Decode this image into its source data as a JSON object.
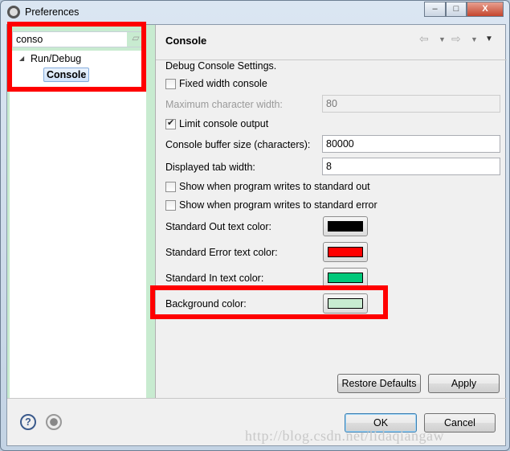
{
  "window": {
    "title": "Preferences",
    "icon": "gear-icon",
    "minimize": "–",
    "maximize": "□",
    "close": "X"
  },
  "filter": {
    "value": "conso",
    "clear_icon": "eraser-icon"
  },
  "tree": [
    {
      "label": "Run/Debug",
      "expanded": true
    },
    {
      "label": "Console",
      "selected": true
    }
  ],
  "page": {
    "title": "Console",
    "description": "Debug Console Settings.",
    "fixed_width": {
      "label": "Fixed width console",
      "checked": false
    },
    "max_width": {
      "label": "Maximum character width:",
      "value": "80",
      "enabled": false
    },
    "limit_output": {
      "label": "Limit console output",
      "checked": true
    },
    "buffer_size": {
      "label": "Console buffer size (characters):",
      "value": "80000"
    },
    "tab_width": {
      "label": "Displayed tab width:",
      "value": "8"
    },
    "show_out": {
      "label": "Show when program writes to standard out",
      "checked": false
    },
    "show_err": {
      "label": "Show when program writes to standard error",
      "checked": false
    },
    "colors": [
      {
        "label": "Standard Out text color:",
        "color": "#000000"
      },
      {
        "label": "Standard Error text color:",
        "color": "#ff0000"
      },
      {
        "label": "Standard In text color:",
        "color": "#00c87a"
      },
      {
        "label": "Background color:",
        "color": "#c8ebd0"
      }
    ],
    "restore_defaults": "Restore Defaults",
    "apply": "Apply"
  },
  "footer": {
    "ok": "OK",
    "cancel": "Cancel",
    "help_icon": "help-icon",
    "record_icon": "record-icon"
  },
  "watermark": "http://blog.csdn.net/lidaqiangaw",
  "highlight_color": "#ff0000"
}
